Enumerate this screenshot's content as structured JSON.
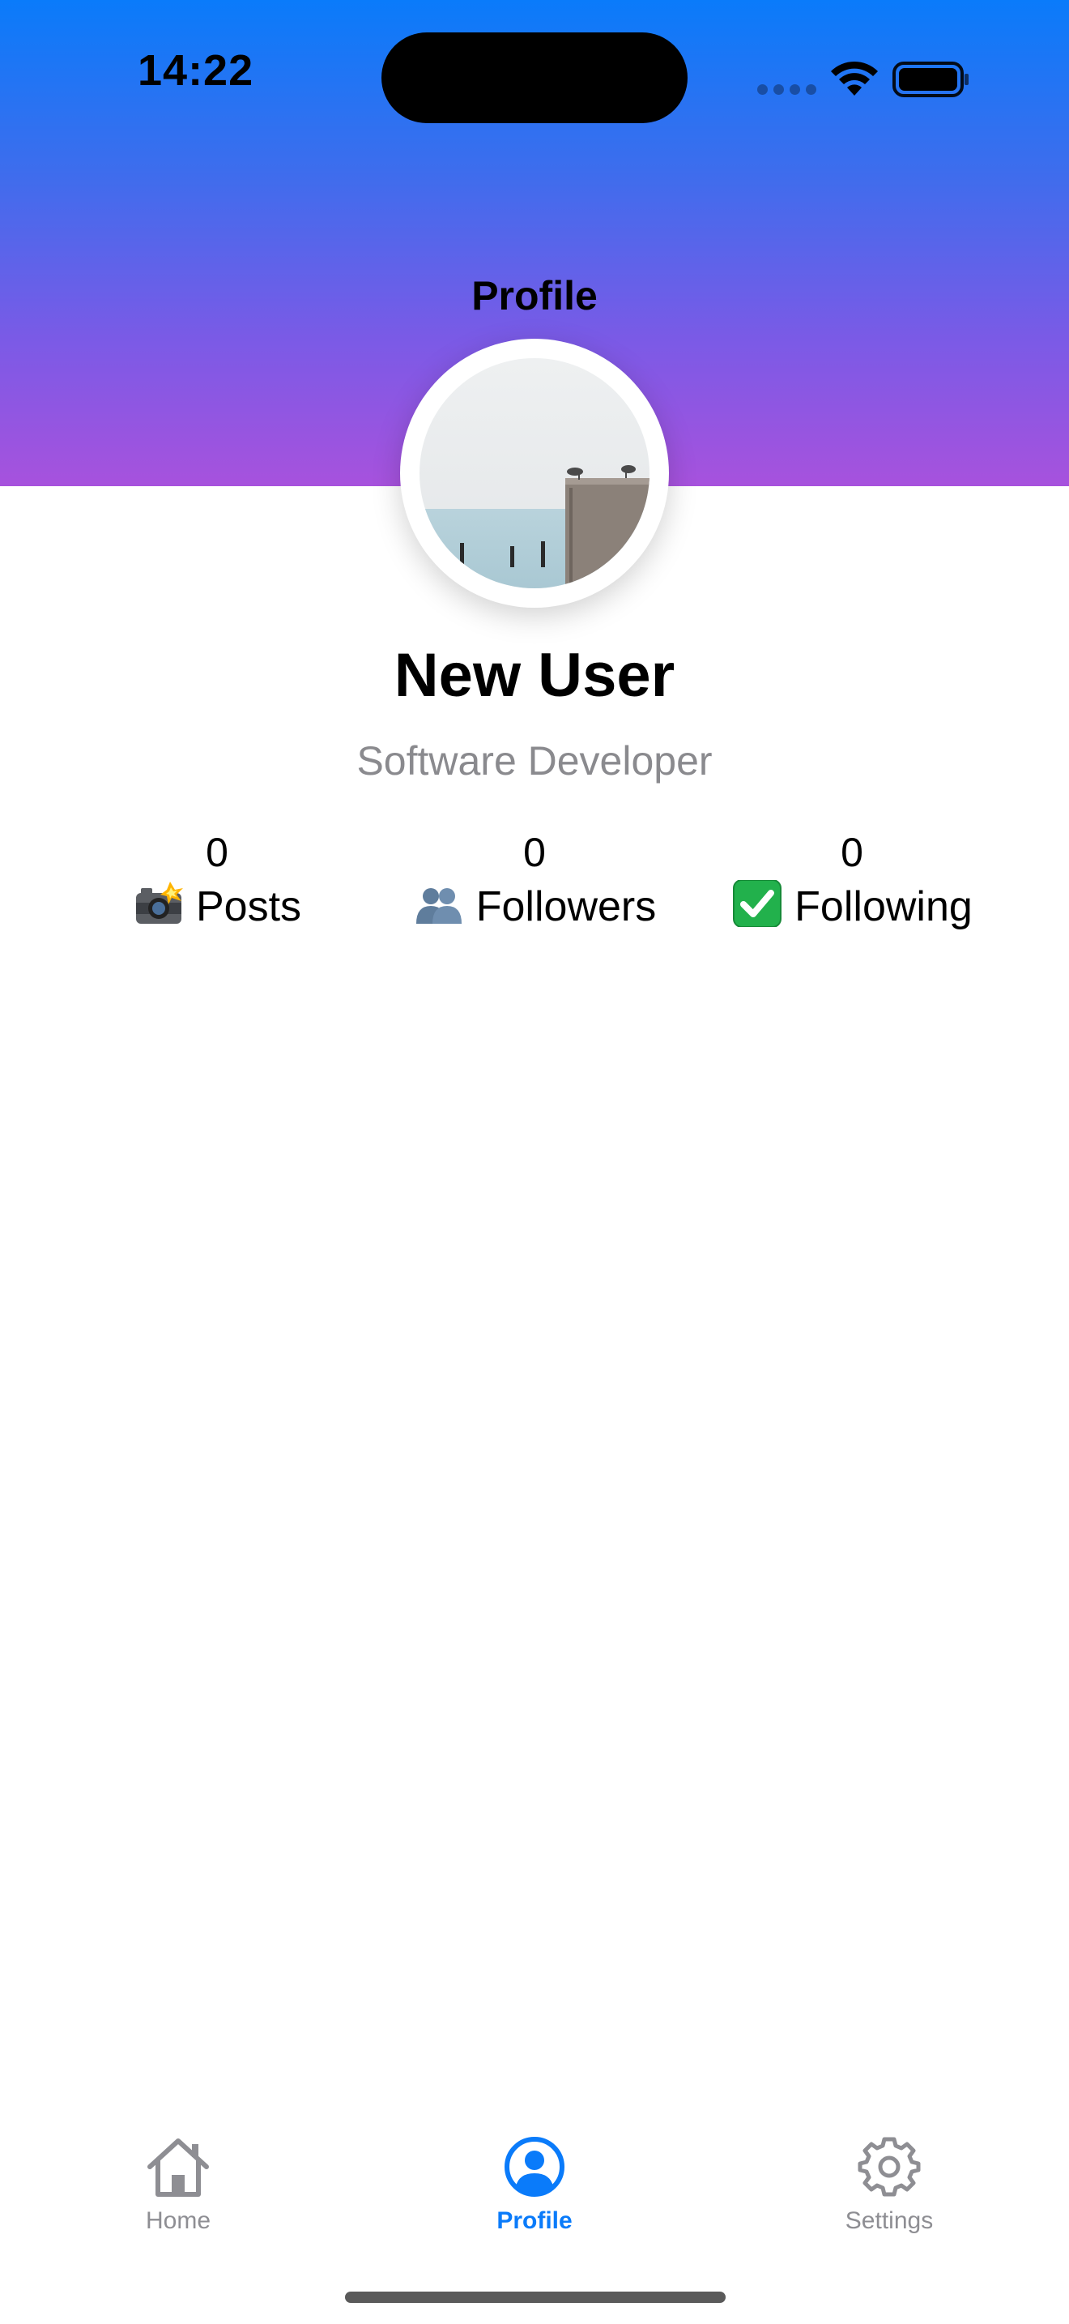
{
  "status_bar": {
    "time": "14:22"
  },
  "navigation": {
    "title": "Profile"
  },
  "profile": {
    "name": "New User",
    "subtitle": "Software Developer"
  },
  "stats": [
    {
      "count": "0",
      "label": "Posts",
      "icon": "camera-flash-emoji"
    },
    {
      "count": "0",
      "label": "Followers",
      "icon": "people-emoji"
    },
    {
      "count": "0",
      "label": "Following",
      "icon": "check-mark-emoji"
    }
  ],
  "tabbar": {
    "items": [
      {
        "label": "Home",
        "icon": "house-icon",
        "active": false
      },
      {
        "label": "Profile",
        "icon": "person-circle-icon",
        "active": true
      },
      {
        "label": "Settings",
        "icon": "gear-icon",
        "active": false
      }
    ]
  },
  "colors": {
    "accent": "#0a7bfa",
    "gradient_top": "#0a7bfa",
    "gradient_bottom": "#a752dd",
    "inactive_tab": "#8e8e93",
    "subtitle": "#8a8a8e"
  }
}
